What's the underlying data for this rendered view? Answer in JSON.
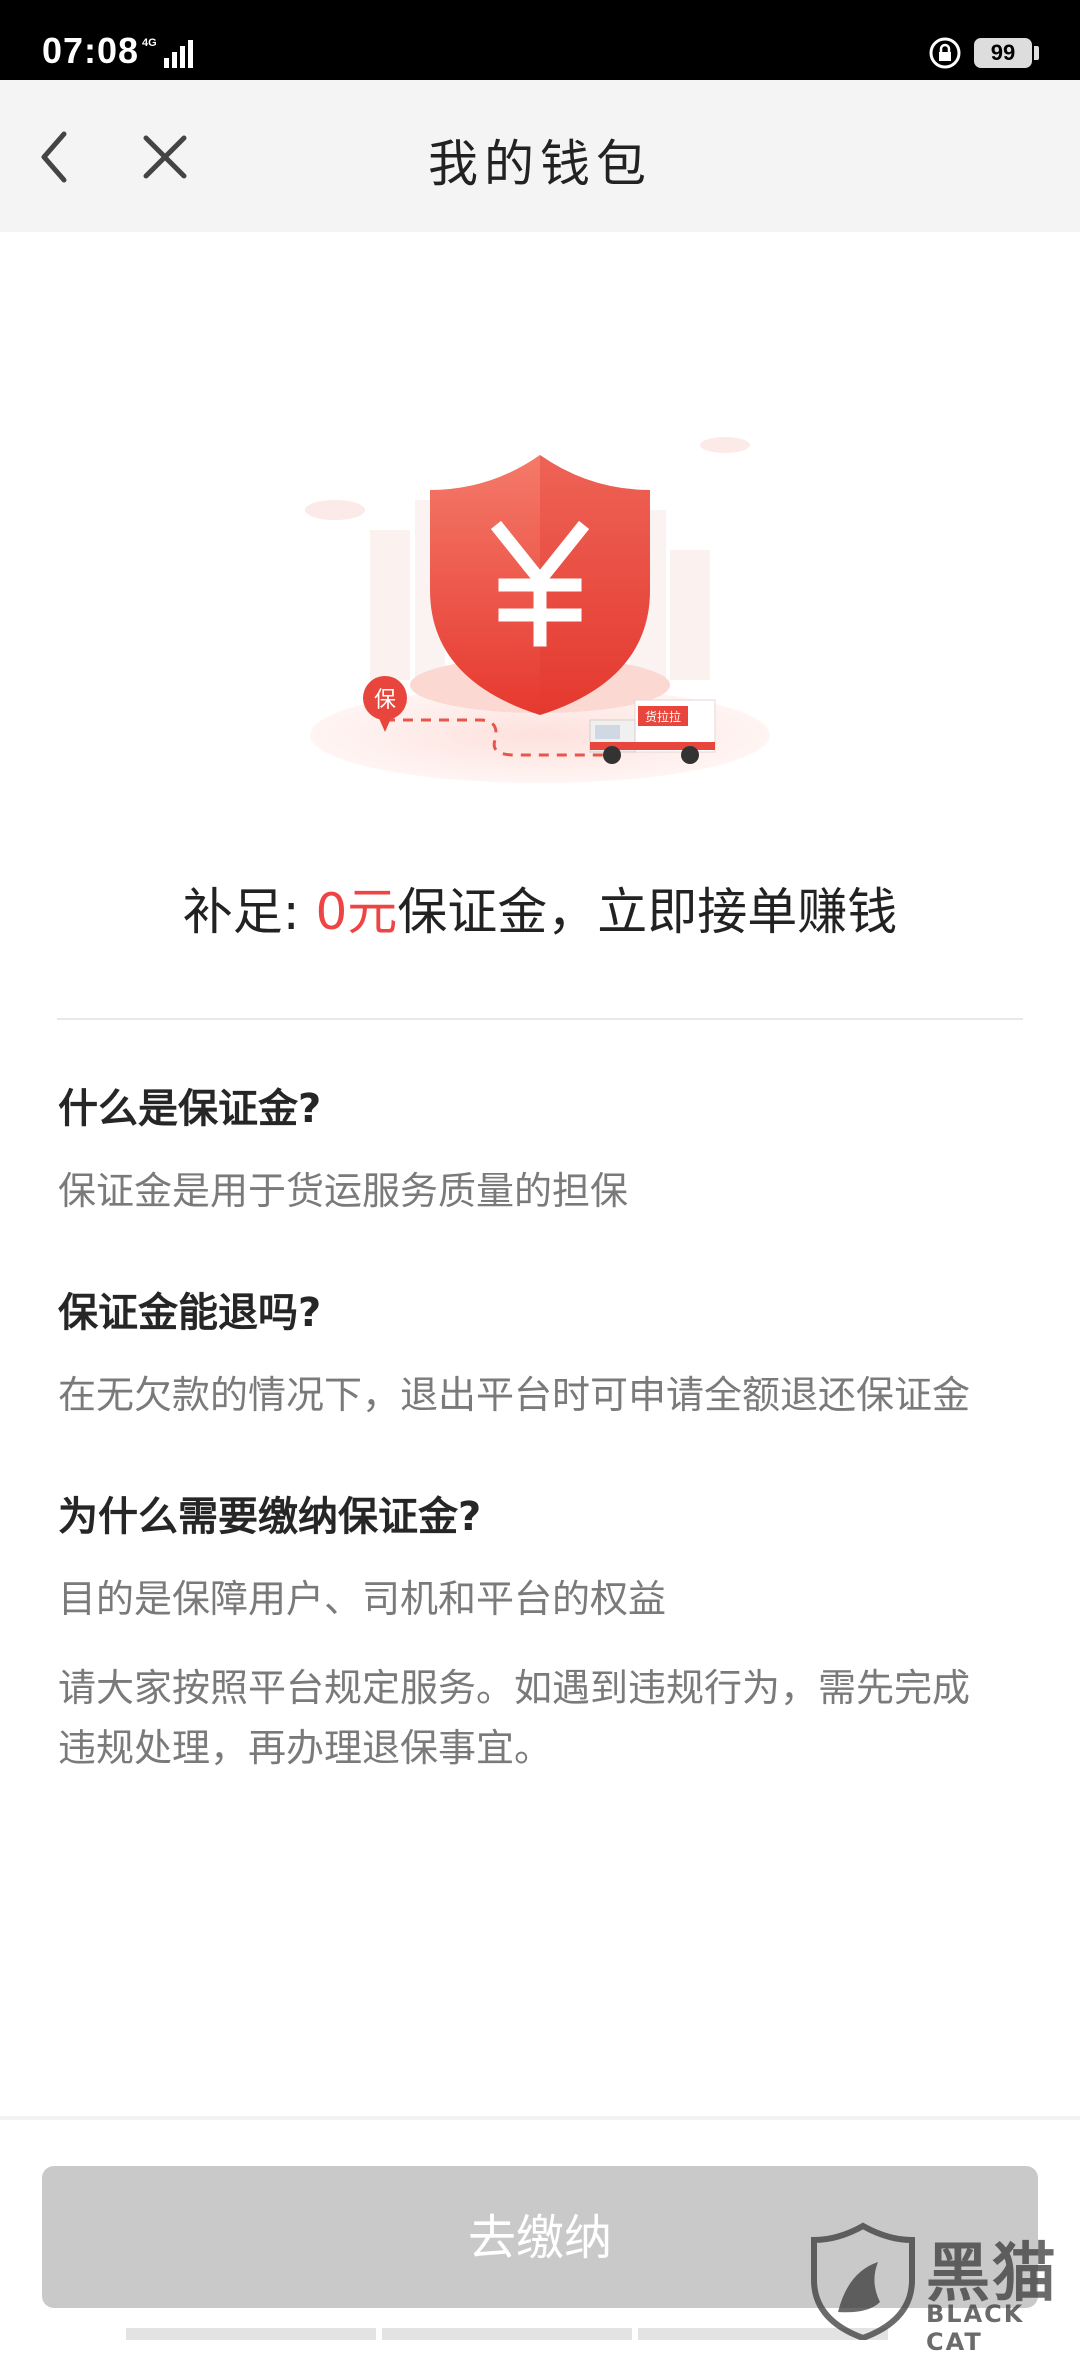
{
  "status_bar": {
    "time": "07:08",
    "network": "4G",
    "battery": "99"
  },
  "navbar": {
    "title": "我的钱包",
    "back_icon": "chevron-left-icon",
    "close_icon": "close-icon"
  },
  "hero": {
    "shield_symbol": "¥",
    "badge": "保",
    "truck_label": "货拉拉"
  },
  "headline": {
    "prefix": "补足: ",
    "amount": "0元",
    "suffix": "保证金，立即接单赚钱"
  },
  "faq": [
    {
      "question": "什么是保证金?",
      "answer": "保证金是用于货运服务质量的担保"
    },
    {
      "question": "保证金能退吗?",
      "answer": "在无欠款的情况下，退出平台时可申请全额退还保证金"
    },
    {
      "question": "为什么需要缴纳保证金?",
      "answer": "目的是保障用户、司机和平台的权益"
    }
  ],
  "notice": {
    "line1": "请大家按照平台规定服务。如遇到违规行为，需先完成",
    "line2": "违规处理，再办理退保事宜。"
  },
  "pay_button": {
    "label": "去缴纳",
    "state": "disabled"
  },
  "watermark": {
    "text": "黑猫",
    "sub": "BLACK CAT"
  },
  "colors": {
    "accent": "#ef4444",
    "button_disabled": "#c9c9c9",
    "navbar_bg": "#f4f4f4"
  }
}
